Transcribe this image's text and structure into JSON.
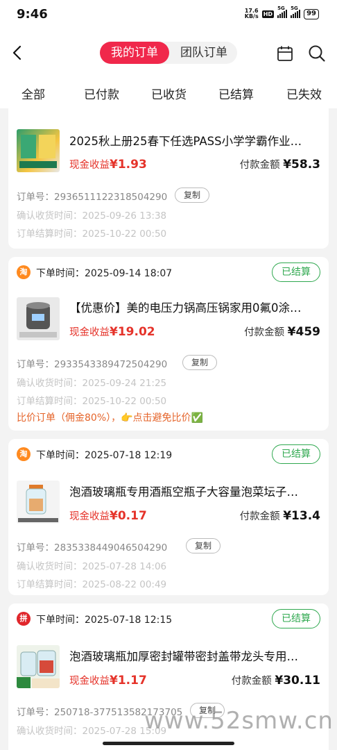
{
  "status": {
    "time": "9:46",
    "net_speed_top": "17.6",
    "net_speed_bottom": "KB/s",
    "hd": "HD",
    "sig1": "5G",
    "sig2": "5G",
    "battery": "99"
  },
  "nav": {
    "seg_my": "我的订单",
    "seg_team": "团队订单"
  },
  "tabs": [
    "全部",
    "已付款",
    "已收货",
    "已结算",
    "已失效"
  ],
  "orders": [
    {
      "title": "2025秋上册25春下任选PASS小学学霸作业…",
      "cash_label": "现金收益",
      "cash": "¥1.93",
      "pay_label": "付款金额",
      "pay": "¥58.3",
      "order_no": "订单号：2936511122318504290",
      "copy": "复制",
      "confirm": "确认收货时间：2025-09-26 13:38",
      "settle": "订单结算时间：2025-10-22 00:50"
    },
    {
      "shop_icon": "淘",
      "order_time": "下单时间：2025-09-14 18:07",
      "badge": "已结算",
      "title": "【优惠价】美的电压力锅高压锅家用0氟0涂…",
      "cash_label": "现金收益",
      "cash": "¥19.02",
      "pay_label": "付款金额",
      "pay": "¥459",
      "order_no": "订单号：2933543389472504290",
      "copy": "复制",
      "confirm": "确认收货时间：2025-09-24 21:25",
      "settle": "订单结算时间：2025-10-22 00:50",
      "compare": "比价订单（佣金80%），👉点击避免比价✅"
    },
    {
      "shop_icon": "淘",
      "order_time": "下单时间：2025-07-18 12:19",
      "badge": "已结算",
      "title": "泡酒玻璃瓶专用酒瓶空瓶子大容量泡菜坛子…",
      "cash_label": "现金收益",
      "cash": "¥0.17",
      "pay_label": "付款金额",
      "pay": "¥13.4",
      "order_no": "订单号：2835338449046504290",
      "copy": "复制",
      "confirm": "确认收货时间：2025-07-28 14:06",
      "settle": "订单结算时间：2025-08-22 00:49"
    },
    {
      "shop_icon": "拼",
      "order_time": "下单时间：2025-07-18 12:15",
      "badge": "已结算",
      "title": "泡酒玻璃瓶加厚密封罐带密封盖带龙头专用…",
      "cash_label": "现金收益",
      "cash": "¥1.17",
      "pay_label": "付款金额",
      "pay": "¥30.11",
      "order_no": "订单号：250718-377513582173705",
      "copy": "复制",
      "confirm": "确认收货时间：2025-07-28 15:09"
    }
  ],
  "watermark": "www.52smw.cn"
}
